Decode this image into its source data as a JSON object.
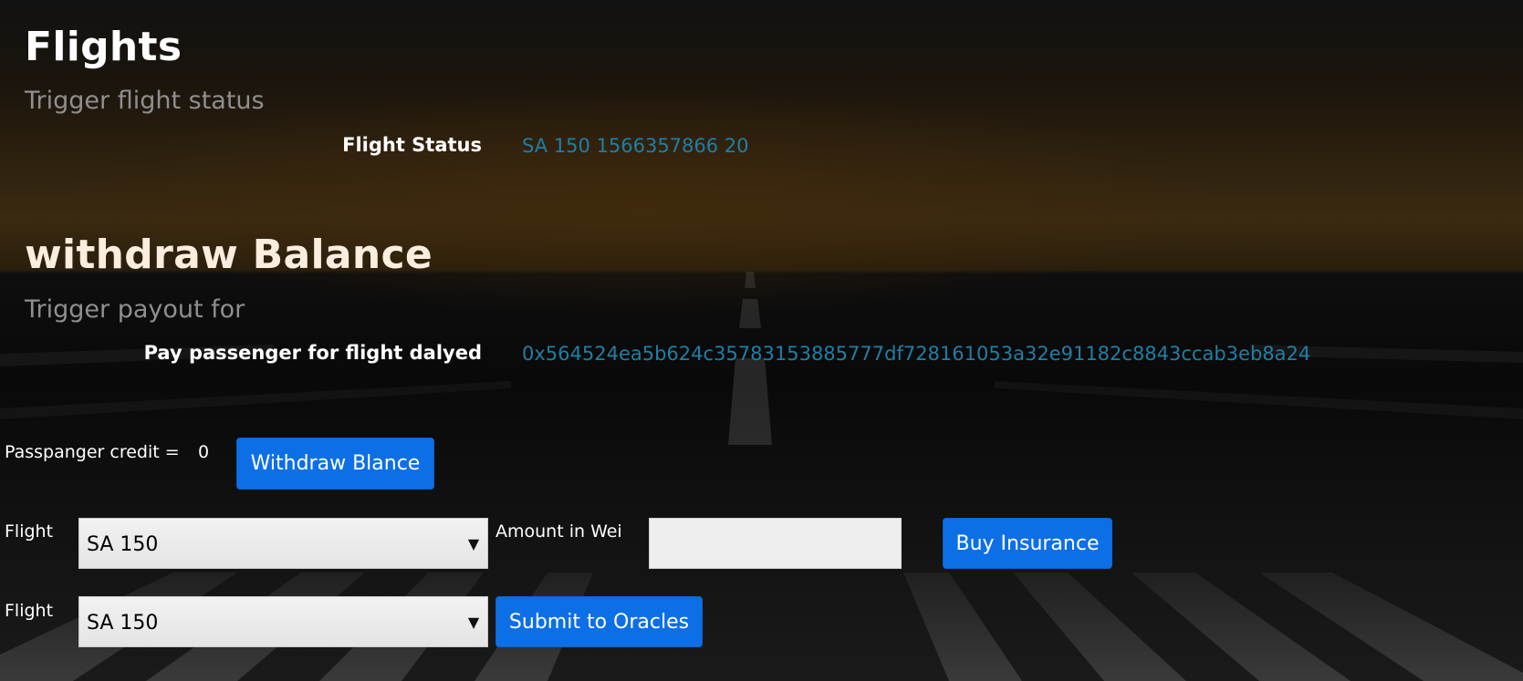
{
  "flights_section": {
    "title": "Flights",
    "subtitle": "Trigger flight status",
    "status_label": "Flight Status",
    "status_value": "SA 150 1566357866 20"
  },
  "withdraw_section": {
    "title": "withdraw Balance",
    "subtitle": "Trigger payout for",
    "pay_label": "Pay passenger for flight dalyed",
    "pay_value": "0x564524ea5b624c35783153885777df728161053a32e91182c8843ccab3eb8a24"
  },
  "credit": {
    "label": "Passpanger credit =",
    "value": "0",
    "withdraw_button": "Withdraw Blance"
  },
  "insurance_form": {
    "flight_label": "Flight",
    "flight_selected": "SA 150",
    "amount_label": "Amount in Wei",
    "amount_value": "",
    "buy_button": "Buy Insurance"
  },
  "oracle_form": {
    "flight_label": "Flight",
    "flight_selected": "SA 150",
    "submit_button": "Submit to Oracles"
  },
  "colors": {
    "button_blue": "#0d6fe6",
    "value_teal": "#1f7fa6",
    "subtitle_gray": "#8f8f8f"
  }
}
